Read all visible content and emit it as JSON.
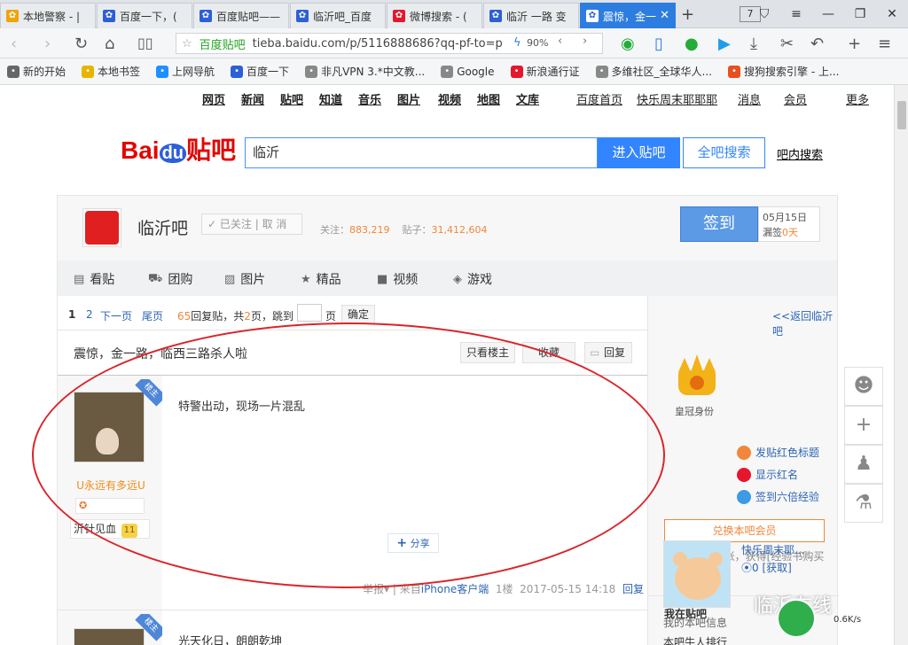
{
  "browser": {
    "tabs": [
      {
        "label": "本地警察 - |",
        "icon": "trophy-icon",
        "color": "#f0a30a"
      },
      {
        "label": "百度一下，(",
        "icon": "baidu-paw-icon",
        "color": "#2d5fd8"
      },
      {
        "label": "百度贴吧——",
        "icon": "baidu-paw-icon",
        "color": "#2d5fd8"
      },
      {
        "label": "临沂吧_百度",
        "icon": "baidu-paw-icon",
        "color": "#2d5fd8"
      },
      {
        "label": "微博搜索 - (",
        "icon": "weibo-icon",
        "color": "#e6162d"
      },
      {
        "label": "临沂 一路 变",
        "icon": "baidu-paw-icon",
        "color": "#2d5fd8"
      },
      {
        "label": "震惊，金一",
        "icon": "baidu-paw-icon",
        "color": "#2d5fd8",
        "active": true
      }
    ],
    "tab_count": "7",
    "url_site_label": "百度贴吧",
    "url": "tieba.baidu.com/p/5116888686?qq-pf-to=p",
    "zoom": "90%",
    "bookmarks": [
      {
        "label": "新的开始",
        "icon": "gear-icon",
        "color": "#666"
      },
      {
        "label": "本地书签",
        "icon": "folder-icon",
        "color": "#e8b400"
      },
      {
        "label": "上网导航",
        "icon": "ie-icon",
        "color": "#1e90ff"
      },
      {
        "label": "百度一下",
        "icon": "baidu-paw-icon",
        "color": "#2d5fd8"
      },
      {
        "label": "非凡VPN 3.*中文教...",
        "icon": "globe-icon",
        "color": "#888"
      },
      {
        "label": "Google",
        "icon": "globe-icon",
        "color": "#888"
      },
      {
        "label": "新浪通行证",
        "icon": "weibo-icon",
        "color": "#e6162d"
      },
      {
        "label": "多维社区_全球华人...",
        "icon": "globe-icon",
        "color": "#888"
      },
      {
        "label": "搜狗搜索引擎 - 上...",
        "icon": "sogou-icon",
        "color": "#e8501f"
      }
    ]
  },
  "page": {
    "top_links": [
      "网页",
      "新闻",
      "贴吧",
      "知道",
      "音乐",
      "图片",
      "视频",
      "地图",
      "文库"
    ],
    "right_links": [
      "百度首页",
      "快乐周末耶耶耶",
      "消息",
      "会员",
      "更多"
    ],
    "logo_text": "Bai",
    "logo_du": "du",
    "logo_tieba": "贴吧",
    "search_value": "临沂",
    "enter_button": "进入贴吧",
    "all_search_button": "全吧搜索",
    "in_bar_search": "吧内搜索",
    "forum_name": "临沂吧",
    "followed_label": "已关注",
    "unfollow_label": "取 消",
    "follow_count_label": "关注：",
    "follow_count": "883,219",
    "post_count_label": "贴子：",
    "post_count": "31,412,604",
    "sign_button": "签到",
    "date": "05月15日",
    "missed_label": "漏签",
    "missed_days": "0天",
    "nav_items": [
      "看贴",
      "团购",
      "图片",
      "精品",
      "视频",
      "游戏"
    ],
    "pager": {
      "current": "1",
      "page2": "2",
      "next": "下一页",
      "last": "尾页",
      "reply_count": "65",
      "reply_text": "回复贴，共",
      "page_total": "2",
      "page_text": "页，跳到",
      "page_unit": "页",
      "confirm": "确定",
      "back_link": "<<返回临沂吧"
    },
    "thread_title": "震惊，金一路，临西三路杀人啦",
    "only_op_button": "只看楼主",
    "collect_button": "收藏",
    "reply_button": "回复",
    "op_badge": "楼主",
    "post1": {
      "username": "U永远有多远U",
      "level_title": "沂针见血",
      "level": "11",
      "content": "特警出动，现场一片混乱",
      "share_label": "分享",
      "report": "举报",
      "source_prefix": "来自",
      "source_client": "iPhone客户端",
      "floor": "1楼",
      "time": "2017-05-15 14:18",
      "reply_link": "回复"
    },
    "post2": {
      "content": "光天化日，朗朗乾坤"
    },
    "sidebar": {
      "crown_label": "皇冠身份",
      "perks": [
        "发贴红色标题",
        "显示红名",
        "签到六倍经验"
      ],
      "member_button": "兑换本吧会员",
      "gift_text": "赠送补签卡1张，获得[经验书购买权]",
      "my_bar_title": "我在贴吧",
      "my_name": "快乐周末耶...",
      "my_coins": "0",
      "my_get": "[获取]",
      "my_info": "我的本吧信息",
      "cut_text": "本吧牛人排行"
    },
    "watermark": "临沂在线",
    "speed": "0.6K/s"
  }
}
